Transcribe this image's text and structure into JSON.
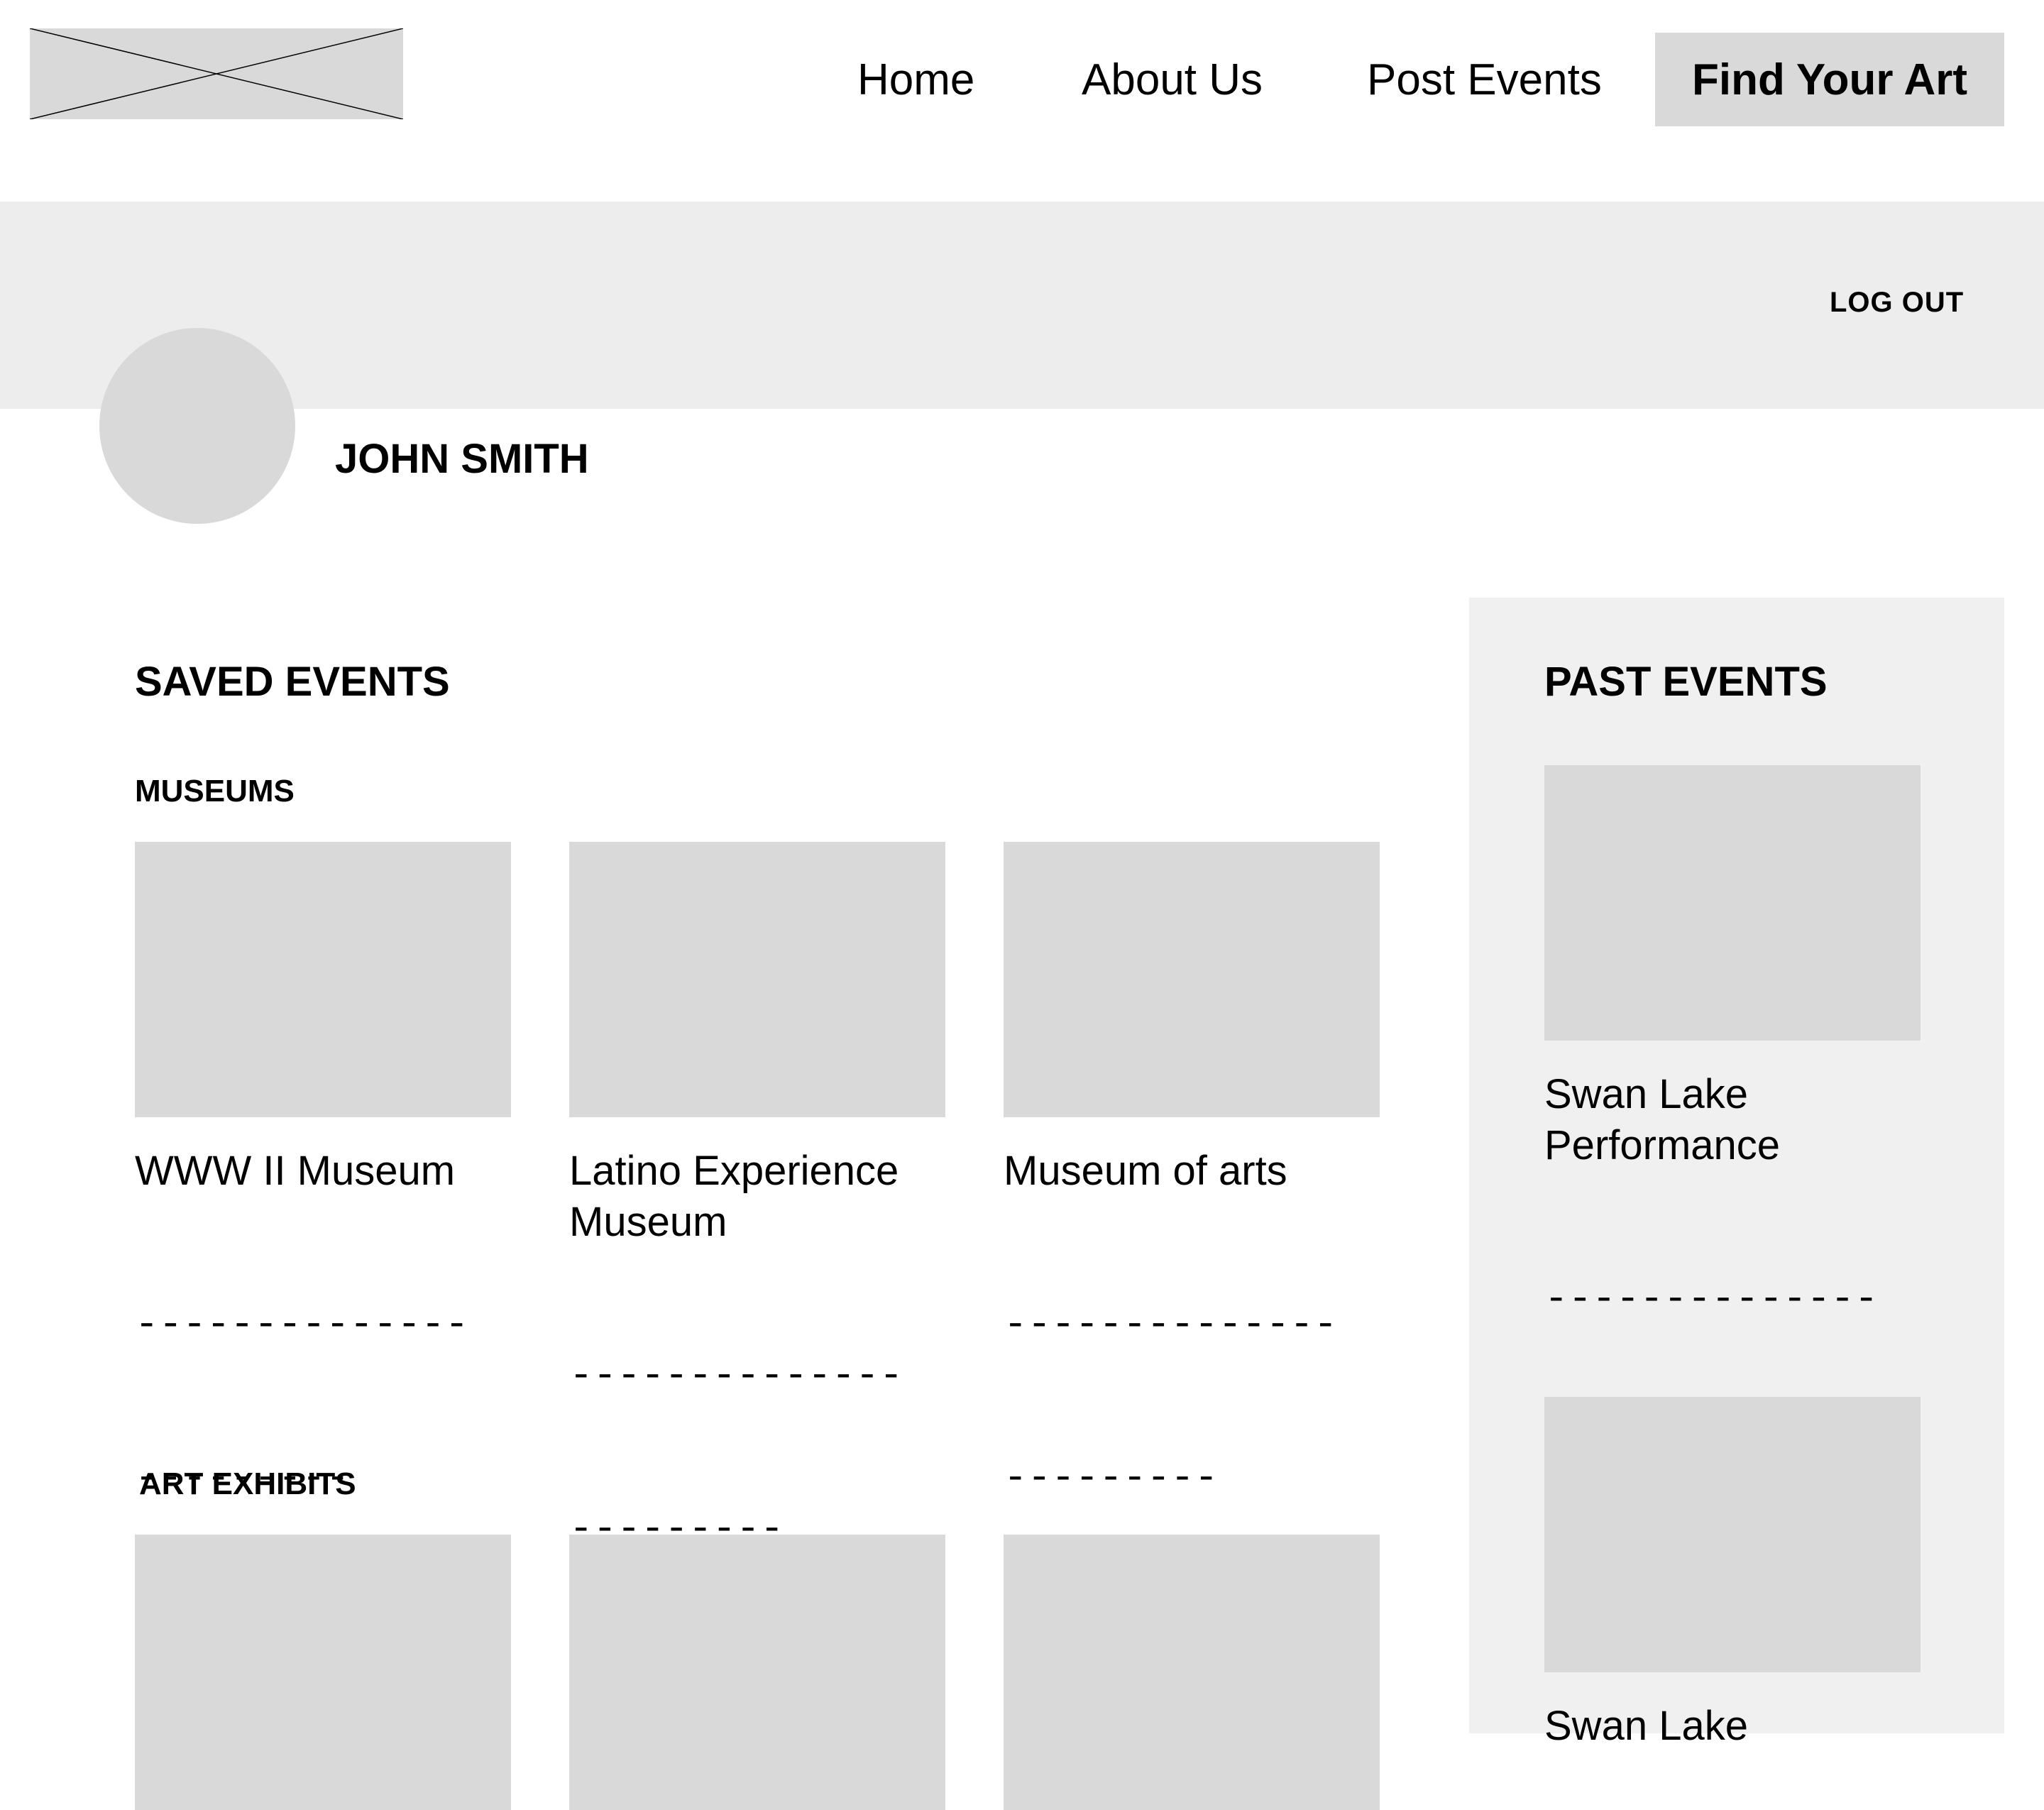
{
  "header": {
    "nav": {
      "home": "Home",
      "about": "About Us",
      "post_events": "Post Events",
      "cta": "Find Your Art"
    }
  },
  "profile": {
    "logout_label": "LOG OUT",
    "name": "JOHN SMITH"
  },
  "saved_events": {
    "title": "SAVED EVENTS",
    "museums": {
      "title": "MUSEUMS",
      "cards": [
        {
          "title": "WWW II Museum",
          "desc": [
            "--------------",
            "---------",
            "-----------"
          ]
        },
        {
          "title": "Latino Experience Museum",
          "desc": [
            "--------------",
            "---------",
            "-----------"
          ]
        },
        {
          "title": "Museum of arts",
          "desc": [
            "--------------",
            "---------",
            "-----------"
          ]
        }
      ]
    },
    "art_exhibits": {
      "title": "ART EXHIBITS"
    }
  },
  "past_events": {
    "title": "PAST EVENTS",
    "cards": [
      {
        "title": "Swan Lake Performance",
        "desc": [
          "--------------",
          "---------",
          "-----------"
        ]
      },
      {
        "title": "Swan Lake"
      }
    ]
  },
  "colors": {
    "placeholder": "#d9d9d9",
    "banner": "#ededed",
    "panel": "#f0f0f0",
    "text": "#000000"
  }
}
